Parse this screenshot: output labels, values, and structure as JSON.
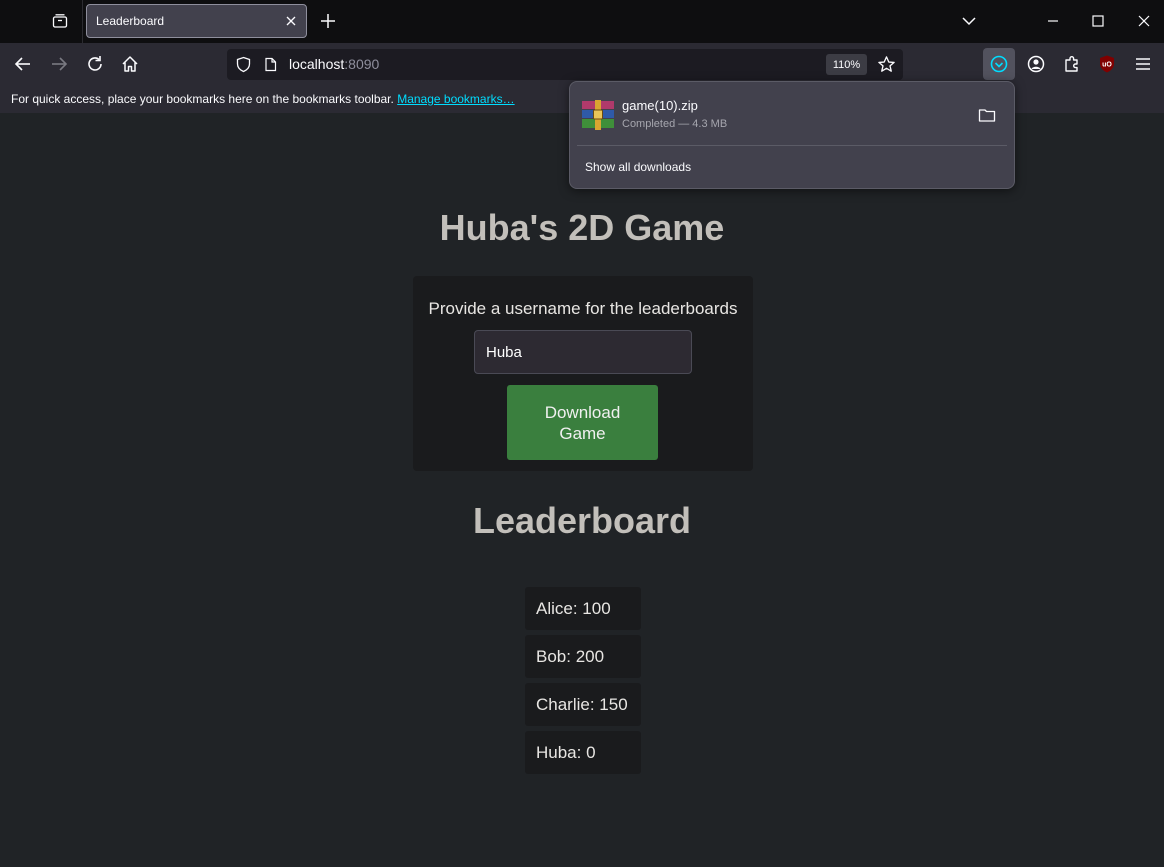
{
  "tab": {
    "title": "Leaderboard"
  },
  "url": {
    "host": "localhost",
    "port": ":8090",
    "zoom": "110%"
  },
  "bookmarks": {
    "message": "For quick access, place your bookmarks here on the bookmarks toolbar.",
    "manage_link": "Manage bookmarks…"
  },
  "downloads_panel": {
    "file_name": "game(10).zip",
    "status": "Completed — 4.3 MB",
    "show_all": "Show all downloads"
  },
  "page": {
    "title": "Huba's 2D Game",
    "prompt": "Provide a username for the leaderboards",
    "username_value": "Huba",
    "download_button": "Download Game",
    "leaderboard_title": "Leaderboard",
    "leaderboard": [
      {
        "text": "Alice: 100"
      },
      {
        "text": "Bob: 200"
      },
      {
        "text": "Charlie: 150"
      },
      {
        "text": "Huba: 0"
      }
    ]
  },
  "icons": {
    "tab_view": "tab-view-icon",
    "close_tab": "close-icon",
    "new_tab": "plus-icon",
    "back": "back-arrow-icon",
    "forward": "forward-arrow-icon",
    "reload": "reload-icon",
    "home": "home-icon",
    "shield": "shield-icon",
    "page": "page-icon",
    "bookmark_star": "star-icon",
    "downloads": "download-icon",
    "account": "account-icon",
    "extensions": "puzzle-icon",
    "ublock": "ublock-icon",
    "menu": "hamburger-menu-icon",
    "folder": "folder-icon",
    "archive": "winrar-archive-icon"
  },
  "colors": {
    "page_background": "#202326",
    "button_green": "#3a7f3e",
    "accent_cyan": "#00ddff",
    "title_text": "#c2bfba"
  }
}
